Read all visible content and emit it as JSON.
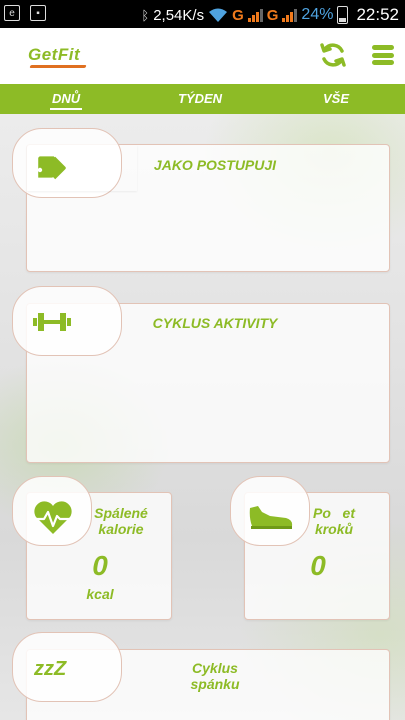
{
  "status_bar": {
    "speed": "2,54K/s",
    "network1": "G",
    "network2": "G",
    "battery": "24%",
    "time": "22:52"
  },
  "app": {
    "logo": "GetFit"
  },
  "tabs": [
    {
      "label": "DNŮ",
      "active": true
    },
    {
      "label": "TÝDEN",
      "active": false
    },
    {
      "label": "VŠE",
      "active": false
    }
  ],
  "cards": {
    "progress": {
      "title": "JAKO POSTUPUJI"
    },
    "activity": {
      "title": "CYKLUS AKTIVITY"
    },
    "calories": {
      "title_line1": "Spálené",
      "title_line2": "kalorie",
      "value": "0",
      "unit": "kcal"
    },
    "steps": {
      "title_line1": "Po   et",
      "title_line2": "kroků",
      "value": "0"
    },
    "sleep": {
      "title_line1": "Cyklus",
      "title_line2": "spánku"
    }
  },
  "colors": {
    "accent": "#8dbb26",
    "logo_underline": "#e07020",
    "card_border": "#e2c3b6"
  }
}
